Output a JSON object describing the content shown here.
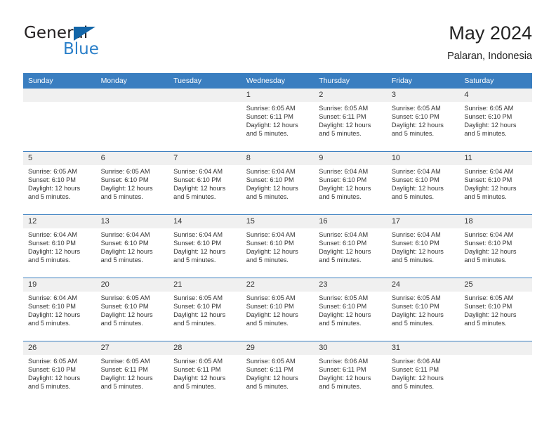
{
  "brand": {
    "name_part1": "General",
    "name_part2": "Blue",
    "triangle_color": "#1265a8",
    "blue_text_color": "#2a7fc9"
  },
  "header": {
    "title": "May 2024",
    "subtitle": "Palaran, Indonesia",
    "header_bg": "#3a7ec0",
    "daynum_bg": "#f0f0f0"
  },
  "weekdays": [
    "Sunday",
    "Monday",
    "Tuesday",
    "Wednesday",
    "Thursday",
    "Friday",
    "Saturday"
  ],
  "weeks": [
    [
      {
        "day": "",
        "sunrise": "",
        "sunset": "",
        "daylight1": "",
        "daylight2": ""
      },
      {
        "day": "",
        "sunrise": "",
        "sunset": "",
        "daylight1": "",
        "daylight2": ""
      },
      {
        "day": "",
        "sunrise": "",
        "sunset": "",
        "daylight1": "",
        "daylight2": ""
      },
      {
        "day": "1",
        "sunrise": "Sunrise: 6:05 AM",
        "sunset": "Sunset: 6:11 PM",
        "daylight1": "Daylight: 12 hours",
        "daylight2": "and 5 minutes."
      },
      {
        "day": "2",
        "sunrise": "Sunrise: 6:05 AM",
        "sunset": "Sunset: 6:11 PM",
        "daylight1": "Daylight: 12 hours",
        "daylight2": "and 5 minutes."
      },
      {
        "day": "3",
        "sunrise": "Sunrise: 6:05 AM",
        "sunset": "Sunset: 6:10 PM",
        "daylight1": "Daylight: 12 hours",
        "daylight2": "and 5 minutes."
      },
      {
        "day": "4",
        "sunrise": "Sunrise: 6:05 AM",
        "sunset": "Sunset: 6:10 PM",
        "daylight1": "Daylight: 12 hours",
        "daylight2": "and 5 minutes."
      }
    ],
    [
      {
        "day": "5",
        "sunrise": "Sunrise: 6:05 AM",
        "sunset": "Sunset: 6:10 PM",
        "daylight1": "Daylight: 12 hours",
        "daylight2": "and 5 minutes."
      },
      {
        "day": "6",
        "sunrise": "Sunrise: 6:05 AM",
        "sunset": "Sunset: 6:10 PM",
        "daylight1": "Daylight: 12 hours",
        "daylight2": "and 5 minutes."
      },
      {
        "day": "7",
        "sunrise": "Sunrise: 6:04 AM",
        "sunset": "Sunset: 6:10 PM",
        "daylight1": "Daylight: 12 hours",
        "daylight2": "and 5 minutes."
      },
      {
        "day": "8",
        "sunrise": "Sunrise: 6:04 AM",
        "sunset": "Sunset: 6:10 PM",
        "daylight1": "Daylight: 12 hours",
        "daylight2": "and 5 minutes."
      },
      {
        "day": "9",
        "sunrise": "Sunrise: 6:04 AM",
        "sunset": "Sunset: 6:10 PM",
        "daylight1": "Daylight: 12 hours",
        "daylight2": "and 5 minutes."
      },
      {
        "day": "10",
        "sunrise": "Sunrise: 6:04 AM",
        "sunset": "Sunset: 6:10 PM",
        "daylight1": "Daylight: 12 hours",
        "daylight2": "and 5 minutes."
      },
      {
        "day": "11",
        "sunrise": "Sunrise: 6:04 AM",
        "sunset": "Sunset: 6:10 PM",
        "daylight1": "Daylight: 12 hours",
        "daylight2": "and 5 minutes."
      }
    ],
    [
      {
        "day": "12",
        "sunrise": "Sunrise: 6:04 AM",
        "sunset": "Sunset: 6:10 PM",
        "daylight1": "Daylight: 12 hours",
        "daylight2": "and 5 minutes."
      },
      {
        "day": "13",
        "sunrise": "Sunrise: 6:04 AM",
        "sunset": "Sunset: 6:10 PM",
        "daylight1": "Daylight: 12 hours",
        "daylight2": "and 5 minutes."
      },
      {
        "day": "14",
        "sunrise": "Sunrise: 6:04 AM",
        "sunset": "Sunset: 6:10 PM",
        "daylight1": "Daylight: 12 hours",
        "daylight2": "and 5 minutes."
      },
      {
        "day": "15",
        "sunrise": "Sunrise: 6:04 AM",
        "sunset": "Sunset: 6:10 PM",
        "daylight1": "Daylight: 12 hours",
        "daylight2": "and 5 minutes."
      },
      {
        "day": "16",
        "sunrise": "Sunrise: 6:04 AM",
        "sunset": "Sunset: 6:10 PM",
        "daylight1": "Daylight: 12 hours",
        "daylight2": "and 5 minutes."
      },
      {
        "day": "17",
        "sunrise": "Sunrise: 6:04 AM",
        "sunset": "Sunset: 6:10 PM",
        "daylight1": "Daylight: 12 hours",
        "daylight2": "and 5 minutes."
      },
      {
        "day": "18",
        "sunrise": "Sunrise: 6:04 AM",
        "sunset": "Sunset: 6:10 PM",
        "daylight1": "Daylight: 12 hours",
        "daylight2": "and 5 minutes."
      }
    ],
    [
      {
        "day": "19",
        "sunrise": "Sunrise: 6:04 AM",
        "sunset": "Sunset: 6:10 PM",
        "daylight1": "Daylight: 12 hours",
        "daylight2": "and 5 minutes."
      },
      {
        "day": "20",
        "sunrise": "Sunrise: 6:05 AM",
        "sunset": "Sunset: 6:10 PM",
        "daylight1": "Daylight: 12 hours",
        "daylight2": "and 5 minutes."
      },
      {
        "day": "21",
        "sunrise": "Sunrise: 6:05 AM",
        "sunset": "Sunset: 6:10 PM",
        "daylight1": "Daylight: 12 hours",
        "daylight2": "and 5 minutes."
      },
      {
        "day": "22",
        "sunrise": "Sunrise: 6:05 AM",
        "sunset": "Sunset: 6:10 PM",
        "daylight1": "Daylight: 12 hours",
        "daylight2": "and 5 minutes."
      },
      {
        "day": "23",
        "sunrise": "Sunrise: 6:05 AM",
        "sunset": "Sunset: 6:10 PM",
        "daylight1": "Daylight: 12 hours",
        "daylight2": "and 5 minutes."
      },
      {
        "day": "24",
        "sunrise": "Sunrise: 6:05 AM",
        "sunset": "Sunset: 6:10 PM",
        "daylight1": "Daylight: 12 hours",
        "daylight2": "and 5 minutes."
      },
      {
        "day": "25",
        "sunrise": "Sunrise: 6:05 AM",
        "sunset": "Sunset: 6:10 PM",
        "daylight1": "Daylight: 12 hours",
        "daylight2": "and 5 minutes."
      }
    ],
    [
      {
        "day": "26",
        "sunrise": "Sunrise: 6:05 AM",
        "sunset": "Sunset: 6:10 PM",
        "daylight1": "Daylight: 12 hours",
        "daylight2": "and 5 minutes."
      },
      {
        "day": "27",
        "sunrise": "Sunrise: 6:05 AM",
        "sunset": "Sunset: 6:11 PM",
        "daylight1": "Daylight: 12 hours",
        "daylight2": "and 5 minutes."
      },
      {
        "day": "28",
        "sunrise": "Sunrise: 6:05 AM",
        "sunset": "Sunset: 6:11 PM",
        "daylight1": "Daylight: 12 hours",
        "daylight2": "and 5 minutes."
      },
      {
        "day": "29",
        "sunrise": "Sunrise: 6:05 AM",
        "sunset": "Sunset: 6:11 PM",
        "daylight1": "Daylight: 12 hours",
        "daylight2": "and 5 minutes."
      },
      {
        "day": "30",
        "sunrise": "Sunrise: 6:06 AM",
        "sunset": "Sunset: 6:11 PM",
        "daylight1": "Daylight: 12 hours",
        "daylight2": "and 5 minutes."
      },
      {
        "day": "31",
        "sunrise": "Sunrise: 6:06 AM",
        "sunset": "Sunset: 6:11 PM",
        "daylight1": "Daylight: 12 hours",
        "daylight2": "and 5 minutes."
      },
      {
        "day": "",
        "sunrise": "",
        "sunset": "",
        "daylight1": "",
        "daylight2": ""
      }
    ]
  ]
}
